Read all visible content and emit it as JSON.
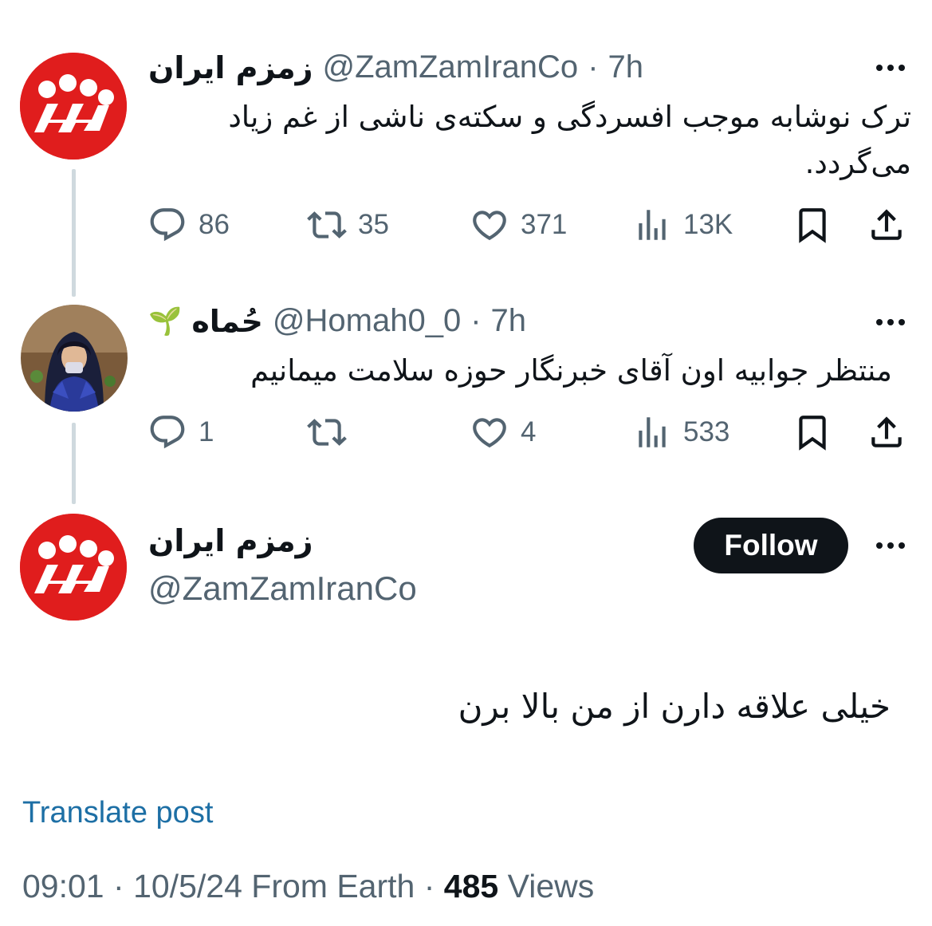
{
  "colors": {
    "brand_red": "#e01d1d",
    "text_primary": "#0f1419",
    "text_secondary": "#536471",
    "link": "#1d6fa5",
    "thread_line": "#cfd9de"
  },
  "thread": [
    {
      "display_name": "زمزم ایران",
      "handle": "@ZamZamIranCo",
      "separator": "·",
      "time": "7h",
      "text": "ترک نوشابه موجب افسردگی و سکته‌ی ناشی از غم زیاد می‌گردد.",
      "replies": "86",
      "retweets": "35",
      "likes": "371",
      "views": "13K"
    },
    {
      "display_name": "حُماه",
      "name_emoji": "🌱",
      "handle": "@Homah0_0",
      "separator": "·",
      "time": "7h",
      "text": "منتظر جوابیه اون آقای خبرنگار حوزه سلامت میمانیم",
      "replies": "1",
      "retweets": "",
      "likes": "4",
      "views": "533"
    }
  ],
  "main_post": {
    "display_name": "زمزم ایران",
    "handle": "@ZamZamIranCo",
    "follow_label": "Follow",
    "text": "خیلی علاقه دارن از من بالا برن",
    "translate_label": "Translate post",
    "time": "09:01",
    "date": "10/5/24",
    "source": "From Earth",
    "separator": "·",
    "views_count": "485",
    "views_label": "Views"
  }
}
